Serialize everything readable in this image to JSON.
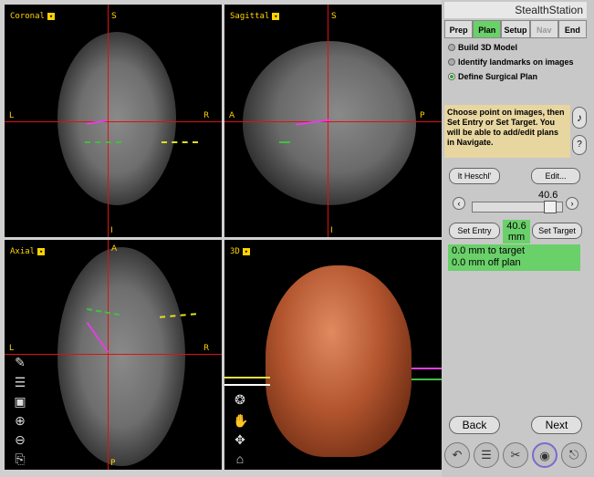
{
  "viewports": {
    "coronal": {
      "label": "Coronal",
      "top": "S",
      "bottom": "I",
      "left": "L",
      "right": "R"
    },
    "sagittal": {
      "label": "Sagittal",
      "top": "S",
      "bottom": "I",
      "left": "A",
      "right": "P"
    },
    "axial": {
      "label": "Axial",
      "top": "A",
      "bottom": "P",
      "left": "L",
      "right": "R"
    },
    "three_d": {
      "label": "3D"
    }
  },
  "sidebar": {
    "app_title": "StealthStation",
    "tabs": [
      "Prep",
      "Plan",
      "Setup",
      "Nav",
      "End"
    ],
    "options": [
      "Build 3D Model",
      "Identify landmarks on images",
      "Define Surgical Plan"
    ],
    "info_text": "Choose point on images, then Set Entry or Set Target. You will be able to add/edit plans in Navigate.",
    "plan_name": "lt Heschl'",
    "edit_label": "Edit...",
    "slider_value": "40.6",
    "set_entry_label": "Set Entry",
    "mm_value": "40.6",
    "mm_unit": "mm",
    "set_target_label": "Set Target",
    "status_line1": "0.0 mm to target",
    "status_line2": "0.0 mm off plan",
    "back_label": "Back",
    "next_label": "Next"
  }
}
